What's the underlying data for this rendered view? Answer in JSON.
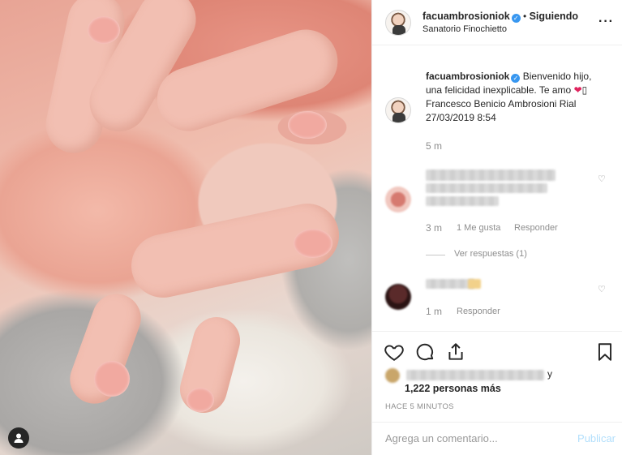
{
  "header": {
    "username": "facuambrosioniok",
    "separator": "•",
    "follow_status": "Siguiendo",
    "location": "Sanatorio Finochietto",
    "more_icon": "more-dots-icon"
  },
  "caption": {
    "username": "facuambrosioniok",
    "text_line1": "Bienvenido hijo,",
    "text_line2": "una felicidad inexplicable. Te amo",
    "heart": "❤",
    "box": "▯",
    "text_line3": "Francesco Benicio Ambrosioni Rial",
    "text_line4": "27/03/2019 8:54",
    "time": "5 m"
  },
  "comments": [
    {
      "time": "3 m",
      "likes": "1 Me gusta",
      "reply": "Responder",
      "view_replies": "Ver respuestas (1)"
    },
    {
      "time": "1 m",
      "reply": "Responder"
    }
  ],
  "actions": {
    "like_icon": "heart-outline-icon",
    "comment_icon": "comment-icon",
    "share_icon": "share-icon",
    "save_icon": "bookmark-icon"
  },
  "likes": {
    "suffix": "y",
    "count_text": "1,222 personas más"
  },
  "posted_ago": "HACE 5 MINUTOS",
  "add_comment": {
    "placeholder": "Agrega un comentario...",
    "publish_label": "Publicar"
  },
  "colors": {
    "verified": "#3897f0",
    "heart": "#e0245e",
    "publish_disabled": "#b2dffc"
  }
}
